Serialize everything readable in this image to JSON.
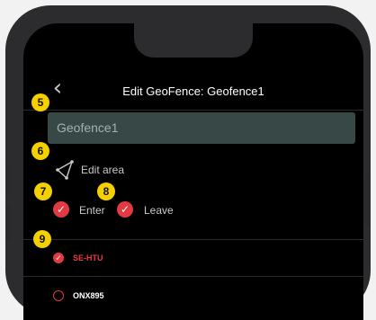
{
  "header": {
    "title": "Edit GeoFence: Geofence1",
    "back_icon": "chevron-left-icon"
  },
  "name_field": {
    "value": "Geofence1"
  },
  "edit_area": {
    "label": "Edit area",
    "icon": "polygon-icon"
  },
  "triggers": [
    {
      "label": "Enter",
      "checked": true
    },
    {
      "label": "Leave",
      "checked": true
    }
  ],
  "badges": [
    "5",
    "6",
    "7",
    "8",
    "9"
  ],
  "vehicles": [
    {
      "label": "SE-HTU",
      "selected": true,
      "color": "#e23a42"
    },
    {
      "label": "ONX895",
      "selected": false,
      "color": "#ffffff"
    }
  ],
  "colors": {
    "accent": "#e23a42",
    "badge": "#f5d000",
    "input_bg": "#384846"
  }
}
